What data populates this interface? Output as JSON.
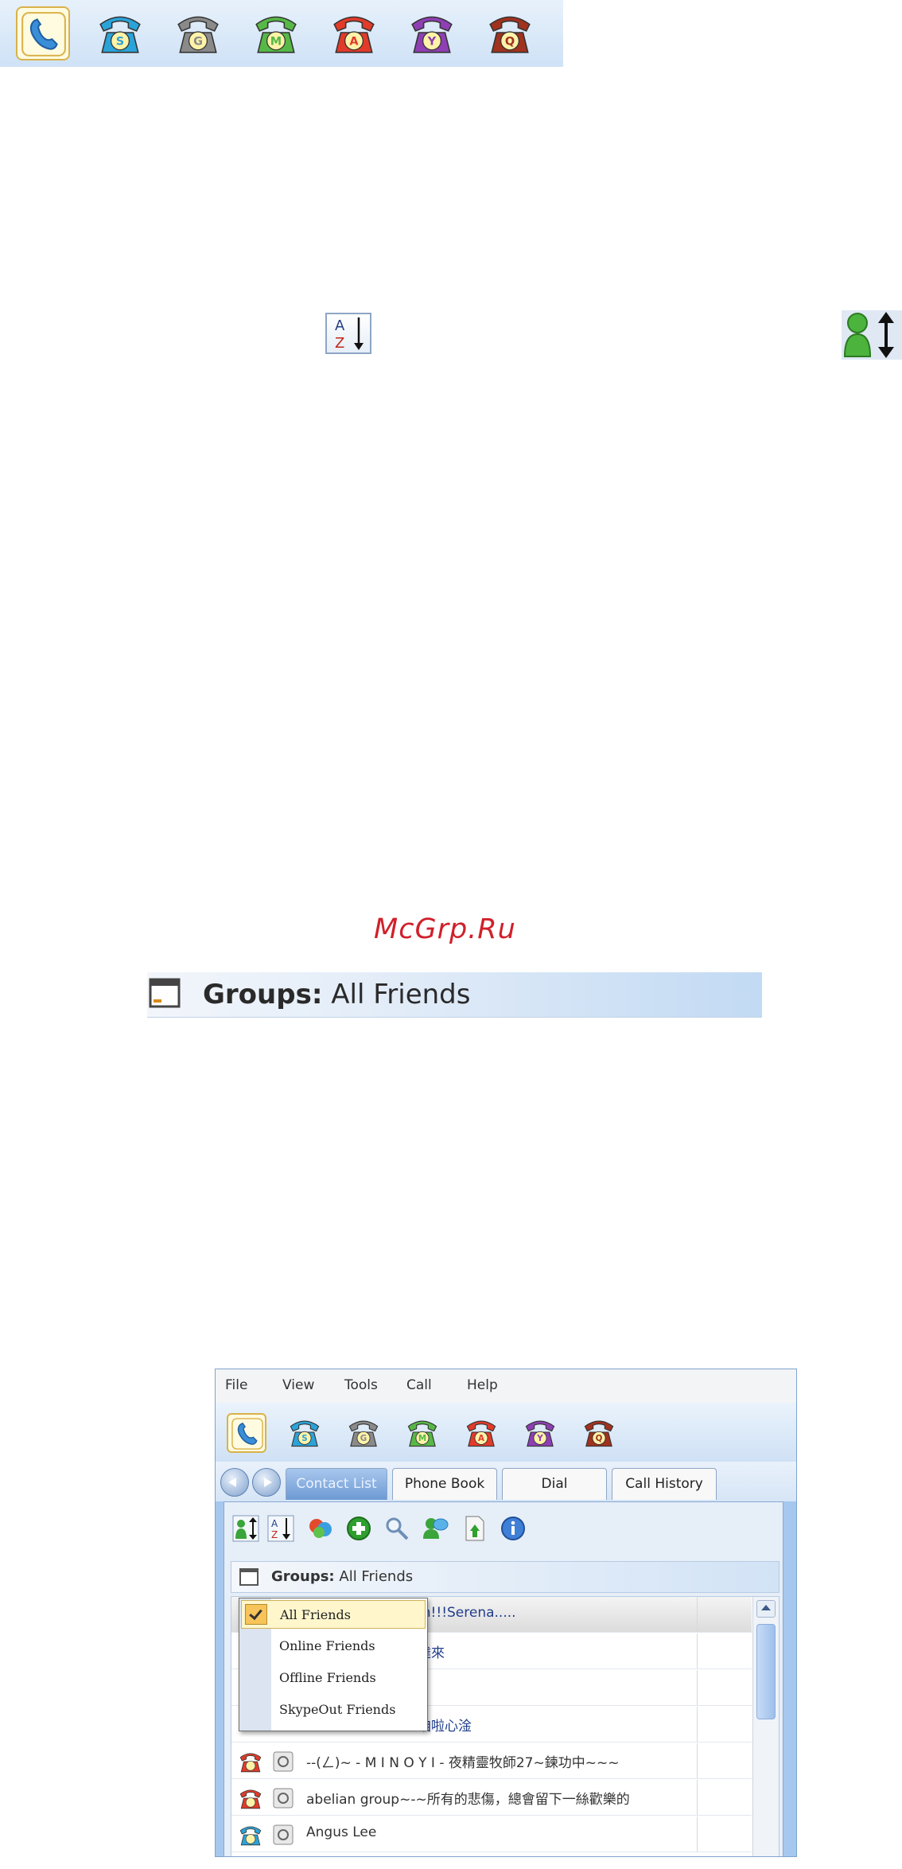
{
  "colors": {
    "skype": "#2aa3d8",
    "google": "#8a8a8a",
    "msn": "#56b846",
    "aim": "#e13b2a",
    "yahoo": "#8e3fb3",
    "qq": "#a0321e",
    "watermark": "#d0202a",
    "menu_highlight": "#fff6cc"
  },
  "phones": [
    {
      "id": "all",
      "letter": "",
      "icon": "handset-icon"
    },
    {
      "id": "skype",
      "letter": "S",
      "icon": "skype-phone-icon"
    },
    {
      "id": "google",
      "letter": "G",
      "icon": "google-phone-icon"
    },
    {
      "id": "msn",
      "letter": "M",
      "icon": "msn-phone-icon"
    },
    {
      "id": "aim",
      "letter": "A",
      "icon": "aim-phone-icon"
    },
    {
      "id": "yahoo",
      "letter": "Y",
      "icon": "yahoo-phone-icon"
    },
    {
      "id": "qq",
      "letter": "Q",
      "icon": "qq-phone-icon"
    }
  ],
  "sort_icons": {
    "alpha_top": "A",
    "alpha_bottom": "Z",
    "alpha_icon": "sort-az-icon",
    "status_icon": "sort-by-status-icon"
  },
  "watermark": "McGrp.Ru",
  "banner": {
    "label": "Groups:",
    "value": "All Friends"
  },
  "app": {
    "menu": [
      "File",
      "View",
      "Tools",
      "Call",
      "Help"
    ],
    "tabs": [
      {
        "label": "Contact List",
        "active": true
      },
      {
        "label": "Phone Book",
        "active": false
      },
      {
        "label": "Dial",
        "active": false
      },
      {
        "label": "Call History",
        "active": false
      }
    ],
    "toolbar_icons": [
      "sort-status-icon",
      "sort-az-icon",
      "refresh-icon",
      "add-icon",
      "search-icon",
      "chat-icon",
      "import-icon",
      "info-icon"
    ],
    "groups_label": "Groups:",
    "groups_value": "All Friends",
    "dropdown": [
      {
        "label": "All Friends",
        "checked": true
      },
      {
        "label": "Online Friends",
        "checked": false
      },
      {
        "label": "Offline Friends",
        "checked": false
      },
      {
        "label": "SkypeOut Friends",
        "checked": false
      }
    ],
    "contacts": [
      {
        "text": "m!!!Serena.....",
        "visible_from": "partial"
      },
      {
        "text": "達來",
        "visible_from": "partial"
      },
      {
        "text": "",
        "visible_from": "partial"
      },
      {
        "text": "咱啦心淦",
        "visible_from": "partial"
      },
      {
        "text": "--(ㄥ)~ - M I N O Y I - 夜精靈牧師27~鍊功中~~~",
        "visible_from": "full",
        "service": "aim"
      },
      {
        "text": "abelian group~-~所有的悲傷，總會留下一絲歡樂的",
        "visible_from": "full",
        "service": "aim"
      },
      {
        "text": "Angus Lee",
        "visible_from": "full",
        "service": "skype"
      }
    ]
  }
}
